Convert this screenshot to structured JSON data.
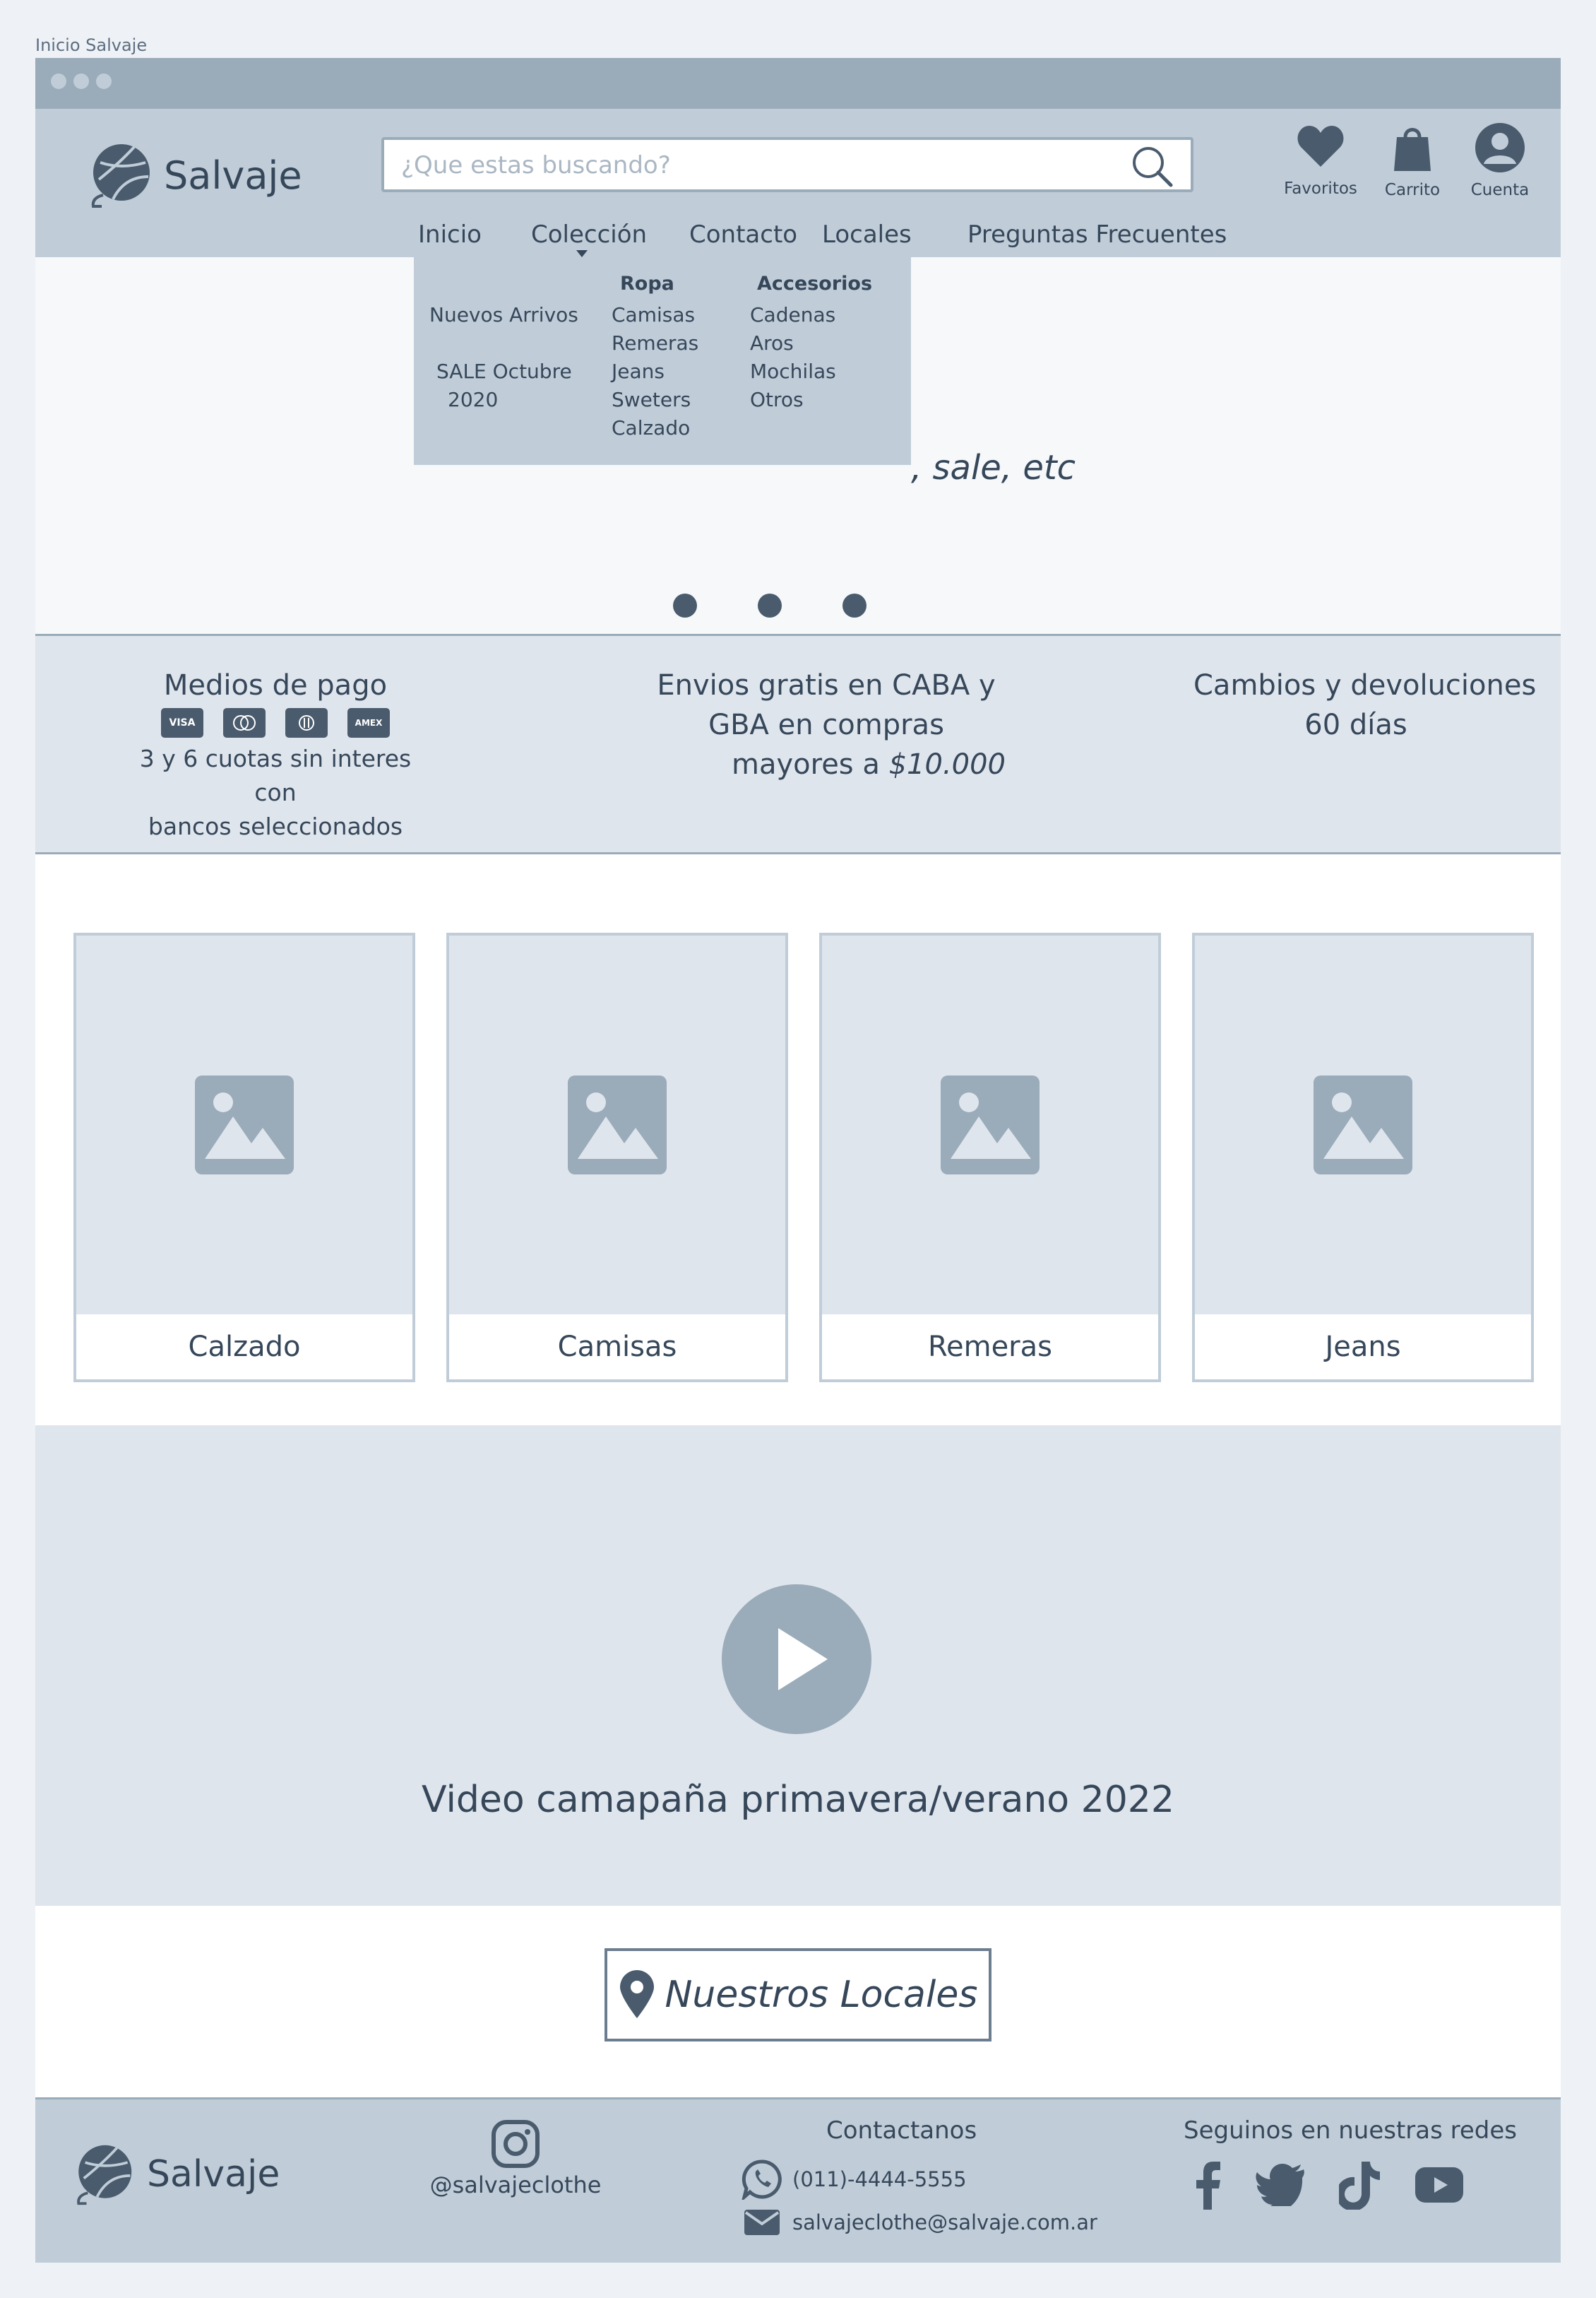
{
  "window": {
    "title": "Inicio Salvaje"
  },
  "header": {
    "brand": "Salvaje",
    "search_placeholder": "¿Que estas buscando?",
    "icons": [
      {
        "name": "heart-icon",
        "label": "Favoritos"
      },
      {
        "name": "shopping-bag-icon",
        "label": "Carrito"
      },
      {
        "name": "user-icon",
        "label": "Cuenta"
      }
    ],
    "nav": [
      "Inicio",
      "Colección",
      "Contacto",
      "Locales",
      "Preguntas Frecuentes"
    ]
  },
  "mega_menu": {
    "left_items": [
      "Nuevos Arrivos",
      "SALE Octubre",
      "2020"
    ],
    "ropa": {
      "title": "Ropa",
      "items": [
        "Camisas",
        "Remeras",
        "Jeans",
        "Sweters",
        "Calzado"
      ]
    },
    "accesorios": {
      "title": "Accesorios",
      "items": [
        "Cadenas",
        "Aros",
        "Mochilas",
        "Otros"
      ]
    }
  },
  "hero": {
    "text": ", sale, etc",
    "slide_count": 3
  },
  "info": {
    "payment": {
      "title": "Medios de pago",
      "cards": [
        "VISA",
        "MC",
        "DC",
        "AMEX"
      ],
      "note_1": "3 y 6 cuotas sin interes con",
      "note_2": "bancos seleccionados"
    },
    "shipping": {
      "line_1": "Envios gratis en CABA y",
      "line_2": "GBA en compras",
      "line_3": "mayores a ",
      "amount": "$10.000"
    },
    "returns": {
      "line_1": "Cambios y devoluciones",
      "line_2": "60 días"
    }
  },
  "categories": [
    "Calzado",
    "Camisas",
    "Remeras",
    "Jeans"
  ],
  "video": {
    "caption": "Video camapaña primavera/verano 2022"
  },
  "locales_button": "Nuestros Locales",
  "footer": {
    "brand": "Salvaje",
    "instagram": "@salvajeclothe",
    "contact_title": "Contactanos",
    "phone": "(011)-4444-5555",
    "email": "salvajeclothe@salvaje.com.ar",
    "social_title": "Seguinos en nuestras redes",
    "social": [
      "facebook-icon",
      "twitter-icon",
      "tiktok-icon",
      "youtube-icon"
    ]
  },
  "colors": {
    "header": "#c0cdd8",
    "band": "#dfe5ed",
    "text": "#36475a",
    "muted": "#9aabb9"
  }
}
